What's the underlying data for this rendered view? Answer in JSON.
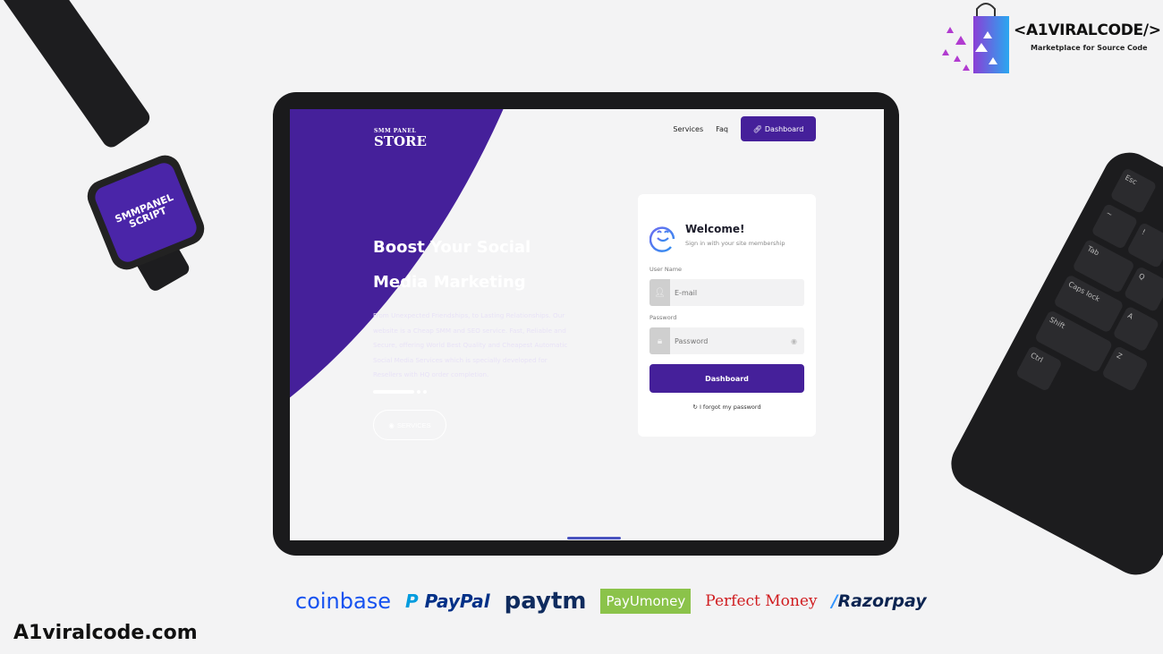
{
  "brand_logo": {
    "title": "<A1VIRALCODE/>",
    "tagline": "Marketplace for Source Code"
  },
  "watch_screen_text": "SMMPANEL SCRIPT",
  "keyboard_keys": [
    "Esc",
    "Tab",
    "Caps lock",
    "Shift",
    "Ctrl",
    "Q",
    "A",
    "Z",
    "~",
    "!"
  ],
  "app": {
    "logo": {
      "line1": "SMM PANEL",
      "line2": "STORE"
    },
    "nav": {
      "services": "Services",
      "faq": "Faq",
      "dashboard": "Dashboard"
    },
    "hero": {
      "title": "Boost Your Social Media Marketing",
      "text": "From Unexpected Friendships, to Lasting Relationships. Our website is a Cheap SMM and SEO service. Fast, Reliable and Secure, offering World Best Quality and Cheapest Automatic Social Media Services which is specially developed for Resellers with HQ order completion.",
      "button": "SERVICES"
    },
    "login": {
      "title": "Welcome!",
      "subtitle": "Sign in with your site membership",
      "username_label": "User Name",
      "username_placeholder": "E-mail",
      "password_label": "Password",
      "password_placeholder": "Password",
      "submit": "Dashboard",
      "forgot": "I forgot my password"
    }
  },
  "payments": [
    "coinbase",
    "PayPal",
    "paytm",
    "PayUmoney",
    "Perfect Money",
    "Razorpay"
  ],
  "payment_colors": {
    "coinbase": "#1652f0",
    "paypal": "#003087",
    "paytm": "#0f2b5e",
    "payumoney": "#8bc34a",
    "perfectmoney": "#d01c1f",
    "razorpay": "#0c2451"
  },
  "accent": "#45209a",
  "site_url": "A1viralcode.com"
}
